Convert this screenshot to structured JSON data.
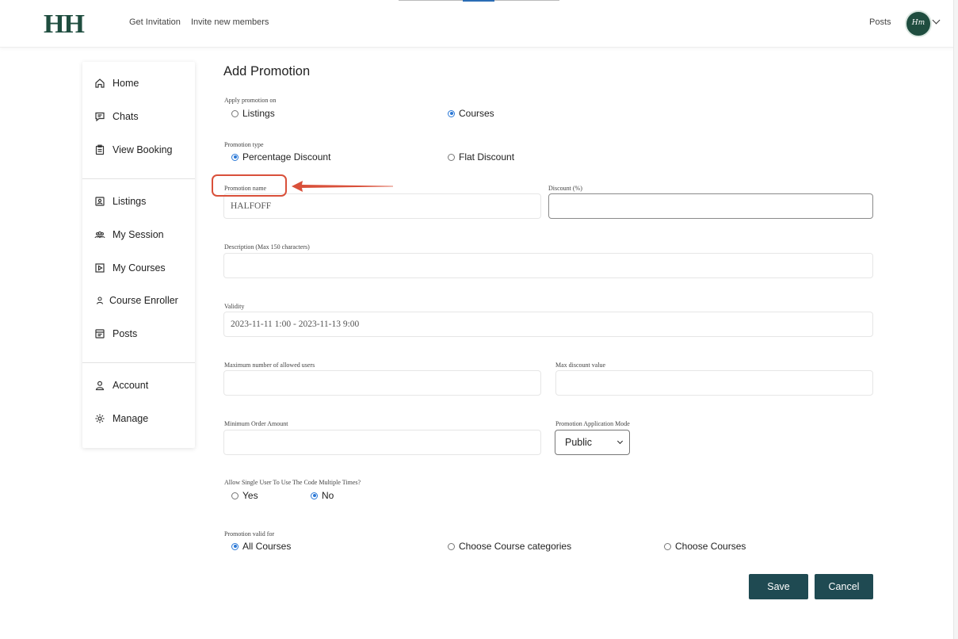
{
  "header": {
    "logo": "HH",
    "nav": [
      "Get Invitation",
      "Invite new members"
    ],
    "posts_link": "Posts",
    "avatar_text": "Hm"
  },
  "sidebar": {
    "items": [
      {
        "label": "Home",
        "icon": "home-icon"
      },
      {
        "label": "Chats",
        "icon": "chat-icon"
      },
      {
        "label": "View Booking",
        "icon": "clipboard-icon"
      },
      {
        "label": "Listings",
        "icon": "listing-icon"
      },
      {
        "label": "My Session",
        "icon": "group-icon"
      },
      {
        "label": "My Courses",
        "icon": "play-icon"
      },
      {
        "label": "Course Enroller",
        "icon": "user-icon"
      },
      {
        "label": "Posts",
        "icon": "posts-icon"
      },
      {
        "label": "Account",
        "icon": "account-icon"
      },
      {
        "label": "Manage",
        "icon": "gear-icon"
      }
    ]
  },
  "form": {
    "title": "Add Promotion",
    "apply_on": {
      "label": "Apply promotion on",
      "options": [
        "Listings",
        "Courses"
      ],
      "selected": "Courses"
    },
    "promo_type": {
      "label": "Promotion type",
      "options": [
        "Percentage Discount",
        "Flat Discount"
      ],
      "selected": "Percentage Discount"
    },
    "promo_name": {
      "label": "Promotion name",
      "value": "HALFOFF"
    },
    "discount": {
      "label": "Discount (%)",
      "value": ""
    },
    "description": {
      "label": "Description (Max 150 characters)",
      "value": ""
    },
    "validity": {
      "label": "Validity",
      "value": "2023-11-11 1:00 - 2023-11-13 9:00"
    },
    "max_users": {
      "label": "Maximum number of allowed users",
      "value": ""
    },
    "max_discount": {
      "label": "Max discount value",
      "value": ""
    },
    "min_order": {
      "label": "Minimum Order Amount",
      "value": ""
    },
    "app_mode": {
      "label": "Promotion Application Mode",
      "selected": "Public"
    },
    "multi_use": {
      "label": "Allow Single User To Use The Code Multiple Times?",
      "options": [
        "Yes",
        "No"
      ],
      "selected": "No"
    },
    "valid_for": {
      "label": "Promotion valid for",
      "options": [
        "All Courses",
        "Choose Course categories",
        "Choose Courses"
      ],
      "selected": "All Courses"
    },
    "save_label": "Save",
    "cancel_label": "Cancel"
  },
  "colors": {
    "brand": "#1f4d3f",
    "button": "#1f4a52",
    "annotation": "#d9503a",
    "radio_on": "#2a78d6"
  }
}
